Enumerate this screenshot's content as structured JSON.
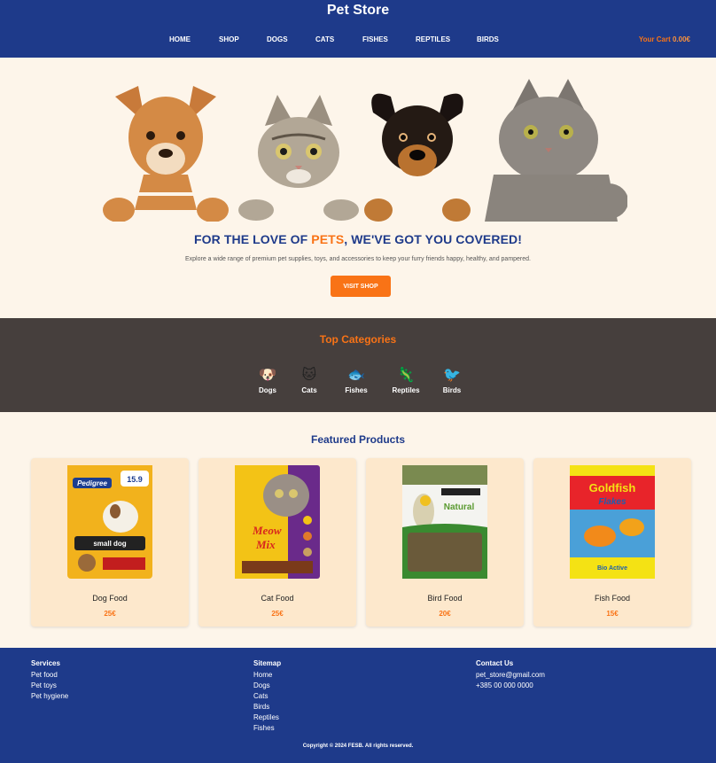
{
  "header": {
    "brand": "Pet Store",
    "nav": [
      "HOME",
      "SHOP",
      "DOGS",
      "CATS",
      "FISHES",
      "REPTILES",
      "BIRDS"
    ],
    "cart_label": "Your Cart",
    "cart_total": "0.00€"
  },
  "hero": {
    "headline_pre": "FOR THE LOVE OF ",
    "headline_accent": "PETS",
    "headline_post": ", WE'VE GOT YOU COVERED!",
    "tagline": "Explore a wide range of premium pet supplies, toys, and accessories to keep your furry friends happy, healthy, and pampered.",
    "cta": "VISIT SHOP"
  },
  "categories": {
    "title": "Top Categories",
    "items": [
      {
        "label": "Dogs",
        "icon": "dog-icon",
        "glyph": "🐶"
      },
      {
        "label": "Cats",
        "icon": "cat-icon",
        "glyph": "🐱"
      },
      {
        "label": "Fishes",
        "icon": "fish-icon",
        "glyph": "🐟"
      },
      {
        "label": "Reptiles",
        "icon": "lizard-icon",
        "glyph": "🦎"
      },
      {
        "label": "Birds",
        "icon": "bird-icon",
        "glyph": "🐦"
      }
    ]
  },
  "featured": {
    "title": "Featured Products",
    "products": [
      {
        "name": "Dog Food",
        "price": "25€",
        "image": "pedigree-bag"
      },
      {
        "name": "Cat Food",
        "price": "25€",
        "image": "meow-mix-bag"
      },
      {
        "name": "Bird Food",
        "price": "20€",
        "image": "bird-seed-bag"
      },
      {
        "name": "Fish Food",
        "price": "15€",
        "image": "goldfish-flakes-box"
      }
    ]
  },
  "footer": {
    "services": {
      "title": "Services",
      "links": [
        "Pet food",
        "Pet toys",
        "Pet hygiene"
      ]
    },
    "sitemap": {
      "title": "Sitemap",
      "links": [
        "Home",
        "Dogs",
        "Cats",
        "Birds",
        "Reptiles",
        "Fishes"
      ]
    },
    "contact": {
      "title": "Contact Us",
      "email": "pet_store@gmail.com",
      "phone": "+385 00 000 0000"
    },
    "copyright": "Copyright © 2024 FESB. All rights reserved."
  },
  "colors": {
    "primary": "#1e3a8a",
    "accent": "#f97316",
    "cream": "#fdf5ea",
    "card": "#fde8cc",
    "dark_band": "#463f3d"
  }
}
